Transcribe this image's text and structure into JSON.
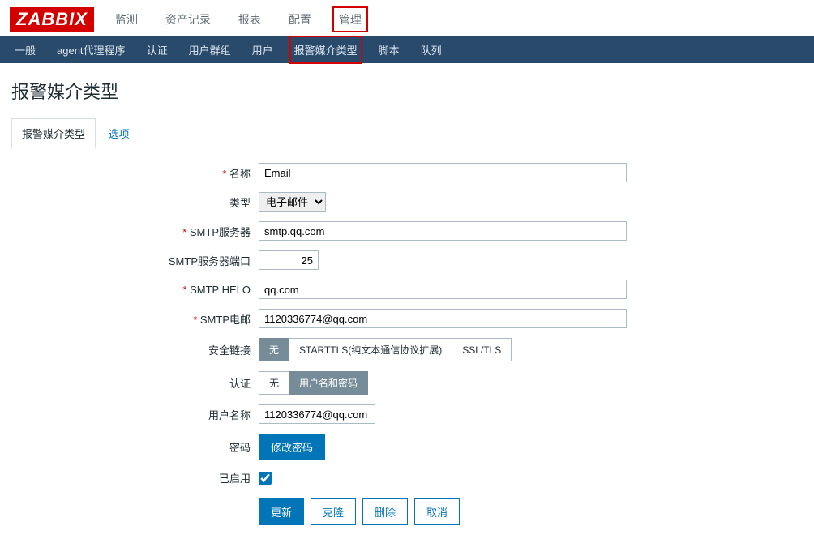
{
  "logo": "ZABBIX",
  "topnav": {
    "items": [
      {
        "label": "监测"
      },
      {
        "label": "资产记录"
      },
      {
        "label": "报表"
      },
      {
        "label": "配置"
      },
      {
        "label": "管理",
        "active": true
      }
    ]
  },
  "subnav": {
    "items": [
      {
        "label": "一般"
      },
      {
        "label": "agent代理程序"
      },
      {
        "label": "认证"
      },
      {
        "label": "用户群组"
      },
      {
        "label": "用户"
      },
      {
        "label": "报警媒介类型",
        "active": true
      },
      {
        "label": "脚本"
      },
      {
        "label": "队列"
      }
    ]
  },
  "page_title": "报警媒介类型",
  "tabs": {
    "items": [
      {
        "label": "报警媒介类型",
        "active": true
      },
      {
        "label": "选项"
      }
    ]
  },
  "form": {
    "name_label": "名称",
    "name_value": "Email",
    "type_label": "类型",
    "type_value": "电子邮件",
    "smtp_server_label": "SMTP服务器",
    "smtp_server_value": "smtp.qq.com",
    "smtp_port_label": "SMTP服务器端口",
    "smtp_port_value": "25",
    "smtp_helo_label": "SMTP HELO",
    "smtp_helo_value": "qq.com",
    "smtp_email_label": "SMTP电邮",
    "smtp_email_value": "1120336774@qq.com",
    "security_label": "安全链接",
    "security_options": [
      "无",
      "STARTTLS(纯文本通信协议扩展)",
      "SSL/TLS"
    ],
    "auth_label": "认证",
    "auth_options": [
      "无",
      "用户名和密码"
    ],
    "username_label": "用户名称",
    "username_value": "1120336774@qq.com",
    "password_label": "密码",
    "password_button": "修改密码",
    "enabled_label": "已启用",
    "enabled_value": true
  },
  "buttons": {
    "update": "更新",
    "clone": "克隆",
    "delete": "删除",
    "cancel": "取消"
  }
}
